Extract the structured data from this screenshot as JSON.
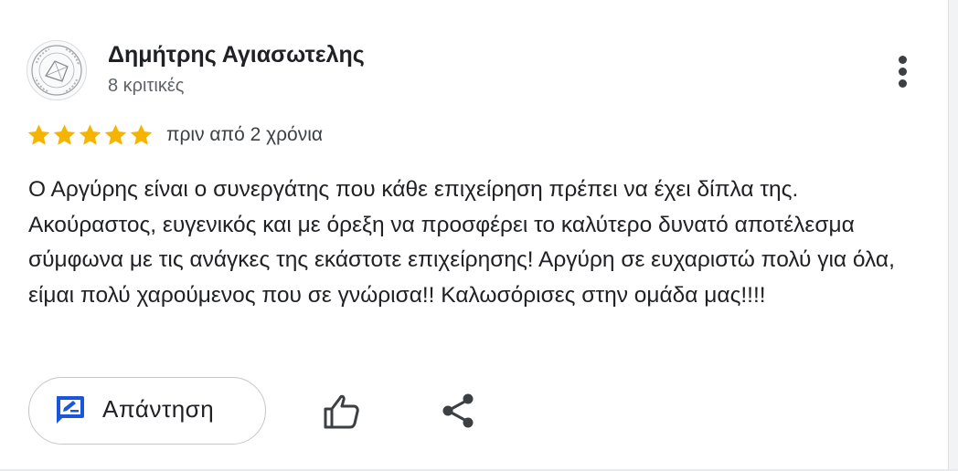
{
  "review": {
    "author_name": "Δημήτρης Αγιασωτελης",
    "review_count": "8 κριτικές",
    "rating": 5,
    "rating_max": 5,
    "date": "πριν από 2 χρόνια",
    "text": "Ο Αργύρης είναι ο συνεργάτης που κάθε επιχείρηση πρέπει να έχει δίπλα της. Ακούραστος, ευγενικός και με όρεξη να προσφέρει το καλύτερο δυνατό αποτέλεσμα σύμφωνα με τις ανάγκες της εκάστοτε επιχείρησης! Αργύρη σε ευχαριστώ πολύ για όλα, είμαι πολύ χαρούμενος που σε γνώρισα!! Καλωσόρισες στην ομάδα μας!!!!"
  },
  "actions": {
    "reply_label": "Απάντηση",
    "reply_icon": "reply-edit-icon",
    "like_icon": "thumbs-up-icon",
    "share_icon": "share-icon",
    "more_icon": "more-vertical-icon"
  },
  "colors": {
    "star": "#f4b400",
    "reply_icon": "#1a56db",
    "text": "#202124",
    "secondary_text": "#5f6368"
  }
}
